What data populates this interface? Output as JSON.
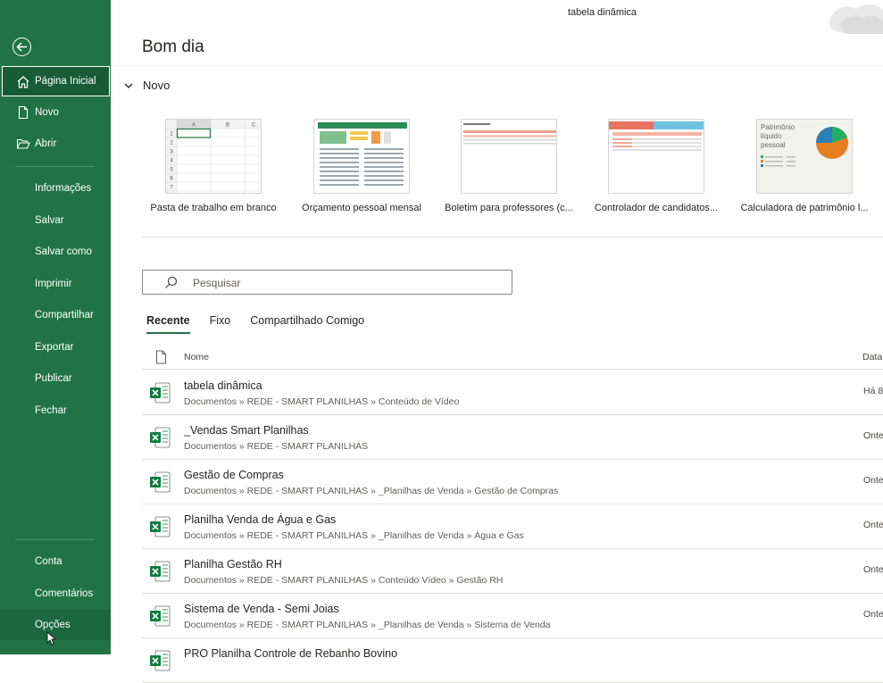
{
  "window": {
    "title": "tabela dinâmica"
  },
  "greeting": "Bom dia",
  "sidebar": {
    "items": [
      {
        "label": "Página Inicial",
        "icon": "home-icon"
      },
      {
        "label": "Novo",
        "icon": "new-document-icon"
      },
      {
        "label": "Abrir",
        "icon": "folder-open-icon"
      },
      {
        "label": "Informações"
      },
      {
        "label": "Salvar"
      },
      {
        "label": "Salvar como"
      },
      {
        "label": "Imprimir"
      },
      {
        "label": "Compartilhar"
      },
      {
        "label": "Exportar"
      },
      {
        "label": "Publicar"
      },
      {
        "label": "Fechar"
      }
    ],
    "bottom": [
      {
        "label": "Conta"
      },
      {
        "label": "Comentários"
      },
      {
        "label": "Opções"
      }
    ]
  },
  "new_section": {
    "title": "Novo",
    "templates": [
      {
        "caption": "Pasta de trabalho em branco",
        "thumb": {
          "cols": [
            "A",
            "B",
            "C"
          ],
          "rows": [
            "1",
            "2",
            "3",
            "4",
            "5",
            "6",
            "7"
          ]
        }
      },
      {
        "caption": "Orçamento pessoal mensal"
      },
      {
        "caption": "Boletim para professores (c..."
      },
      {
        "caption": "Controlador de candidatos..."
      },
      {
        "caption": "Calculadora de patrimônio l...",
        "thumb": {
          "line1": "Patrimônio",
          "line2": "líquido",
          "line3": "pessoal"
        }
      }
    ]
  },
  "search": {
    "placeholder": "Pesquisar"
  },
  "tabs": [
    "Recente",
    "Fixo",
    "Compartilhado Comigo"
  ],
  "list": {
    "col_name": "Nome",
    "col_date": "Data",
    "files": [
      {
        "name": "tabela dinâmica",
        "path": "Documentos » REDE - SMART PLANILHAS » Conteúdo de Vídeo",
        "date": "Há 8"
      },
      {
        "name": "_Vendas Smart Planilhas",
        "path": "Documentos » REDE - SMART PLANILHAS",
        "date": "Onte"
      },
      {
        "name": "Gestão de Compras",
        "path": "Documentos » REDE - SMART PLANILHAS » _Planilhas de Venda » Gestão de Compras",
        "date": "Onte"
      },
      {
        "name": "Planilha Venda de Água e Gas",
        "path": "Documentos » REDE - SMART PLANILHAS » _Planilhas de Venda » Água e Gas",
        "date": "Onte"
      },
      {
        "name": "Planilha Gestão RH",
        "path": "Documentos » REDE - SMART PLANILHAS » Conteúdo Vídeo » Gestão RH",
        "date": "Onte"
      },
      {
        "name": "Sistema de Venda - Semi Joias",
        "path": "Documentos » REDE - SMART PLANILHAS » _Planilhas de Venda » Sistema de Venda",
        "date": "Onte"
      },
      {
        "name": "PRO Planilha Controle de Rebanho Bovino",
        "path": "",
        "date": ""
      }
    ]
  },
  "colors": {
    "sidebar": "#217346",
    "sidebar_active": "#185c37",
    "excel_green": "#107c41",
    "accent": "#217346"
  }
}
